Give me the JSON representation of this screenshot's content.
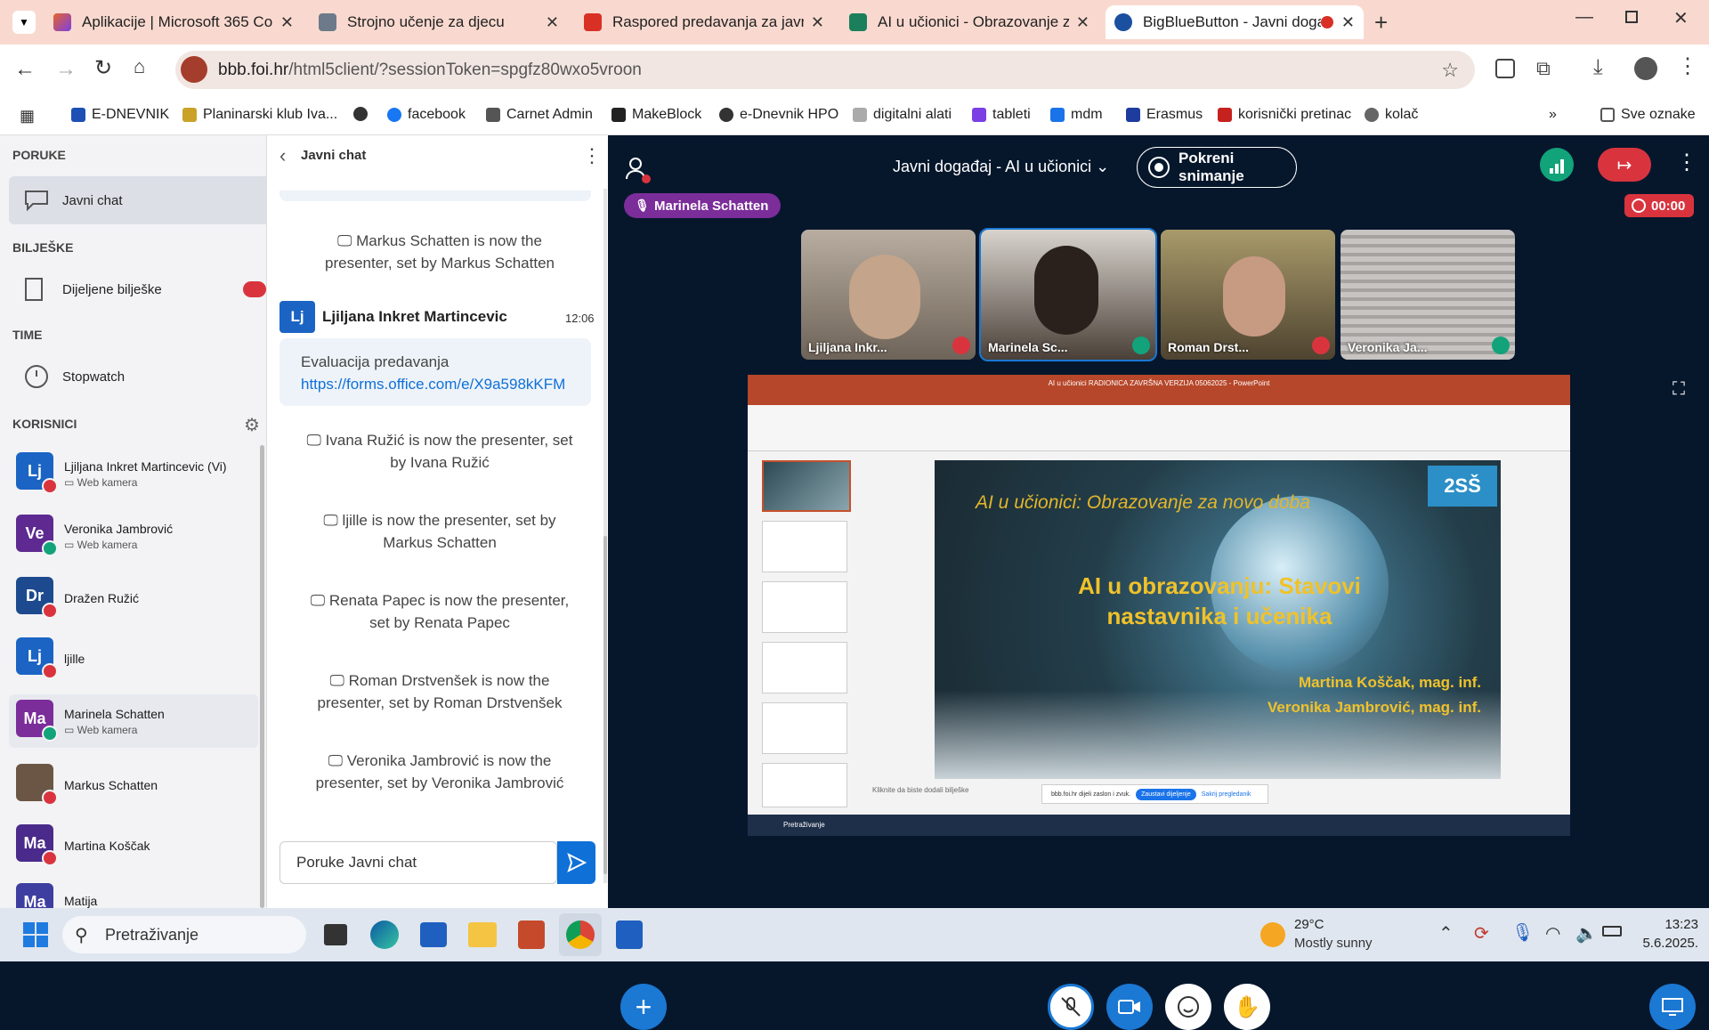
{
  "browser": {
    "tabs": [
      {
        "title": "Aplikacije | Microsoft 365 Copil",
        "color": "#e8632b"
      },
      {
        "title": "Strojno učenje za djecu",
        "color": "#6c7a89"
      },
      {
        "title": "Raspored predavanja za javni d",
        "color": "#d93025"
      },
      {
        "title": "AI u učionici - Obrazovanje za",
        "color": "#1a7f5a"
      },
      {
        "title": "BigBlueButton - Javni događ",
        "color": "#1b4fa0"
      }
    ],
    "url_host": "bbb.foi.hr",
    "url_path": "/html5client/?sessionToken=spgfz80wxo5vroon",
    "bookmarks": [
      "E-DNEVNIK",
      "Planinarski klub Iva...",
      "facebook",
      "Carnet Admin",
      "MakeBlock",
      "e-Dnevnik HPO",
      "digitalni alati",
      "tableti",
      "mdm",
      "Erasmus",
      "korisnički pretinac",
      "kolač"
    ],
    "all_bookmarks": "Sve oznake"
  },
  "sidebar": {
    "messages_heading": "PORUKE",
    "public_chat": "Javni chat",
    "notes_heading": "BILJEŠKE",
    "shared_notes": "Dijeljene bilješke",
    "time_heading": "TIME",
    "stopwatch": "Stopwatch",
    "users_heading": "KORISNICI",
    "users": [
      {
        "initials": "Lj",
        "name": "Ljiljana Inkret Martincevic (Vi)",
        "sub": "Web kamera",
        "color": "#1b64c4",
        "status": "#d9343e"
      },
      {
        "initials": "Ve",
        "name": "Veronika Jambrović",
        "sub": "Web kamera",
        "color": "#5e2a91",
        "status": "#12a37a"
      },
      {
        "initials": "Dr",
        "name": "Dražen Ružić",
        "sub": "",
        "color": "#1d4a8e",
        "status": "#d9343e"
      },
      {
        "initials": "Lj",
        "name": "ljille",
        "sub": "",
        "color": "#1b64c4",
        "status": "#d9343e"
      },
      {
        "initials": "Ma",
        "name": "Marinela Schatten",
        "sub": "Web kamera",
        "color": "#7b2d9a",
        "status": "#12a37a"
      },
      {
        "initials": "",
        "name": "Markus Schatten",
        "sub": "",
        "color": "#6b5645",
        "status": "#d9343e"
      },
      {
        "initials": "Ma",
        "name": "Martina Koščak",
        "sub": "",
        "color": "#4a2a8a",
        "status": "#d9343e"
      },
      {
        "initials": "Ma",
        "name": "Matija",
        "sub": "",
        "color": "#3e3ea0",
        "status": "#d9343e"
      }
    ]
  },
  "chat": {
    "title": "Javni chat",
    "sys1": "Markus Schatten is now the presenter, set by Markus Schatten",
    "author": "Ljiljana Inkret Martincevic",
    "author_initials": "Lj",
    "time": "12:06",
    "msg_line1": "Evaluacija predavanja",
    "msg_link": "https://forms.office.com/e/X9a598kKFM",
    "sys2": "Ivana Ružić is now the presenter, set by Ivana Ružić",
    "sys3": "ljille is now the presenter, set by Markus Schatten",
    "sys4": "Renata Papec is now the presenter, set by Renata Papec",
    "sys5": "Roman Drstvenšek is now the presenter, set by Roman Drstvenšek",
    "sys6": "Veronika Jambrović is now the presenter, set by Veronika Jambrović",
    "input_placeholder": "Poruke Javni chat"
  },
  "meeting": {
    "title": "Javni događaj - AI u učionici",
    "record_button": "Pokreni snimanje",
    "talker": "Marinela Schatten",
    "record_time": "00:00",
    "videos": [
      {
        "name": "Ljiljana Inkr...",
        "bg": "#8d8275",
        "muted": true
      },
      {
        "name": "Marinela Sc...",
        "bg": "#7a7068",
        "muted": false
      },
      {
        "name": "Roman Drst...",
        "bg": "#6c6040",
        "muted": true
      },
      {
        "name": "Veronika Ja...",
        "bg": "#a4a1a0",
        "muted": false
      }
    ]
  },
  "slide": {
    "header_text": "AI u učionici RADIONICA ZAVRŠNA VERZIJA 05062025 - PowerPoint",
    "top_title": "AI u učionici: Obrazovanje za novo doba",
    "main_title_1": "AI u obrazovanju: Stavovi",
    "main_title_2": "nastavnika i učenika",
    "author1": "Martina Koščak, mag. inf.",
    "author2": "Veronika Jambrović, mag. inf.",
    "notes_placeholder": "Kliknite da biste dodali bilješke",
    "share_notice": "bbb.foi.hr dijeli zaslon i zvuk.",
    "stop_share": "Zaustavi dijeljenje",
    "hide": "Sakrij pregledanik",
    "inner_search": "Pretraživanje"
  },
  "taskbar": {
    "search": "Pretraživanje",
    "temp": "29°C",
    "weather": "Mostly sunny",
    "time": "13:23",
    "date": "5.6.2025."
  }
}
